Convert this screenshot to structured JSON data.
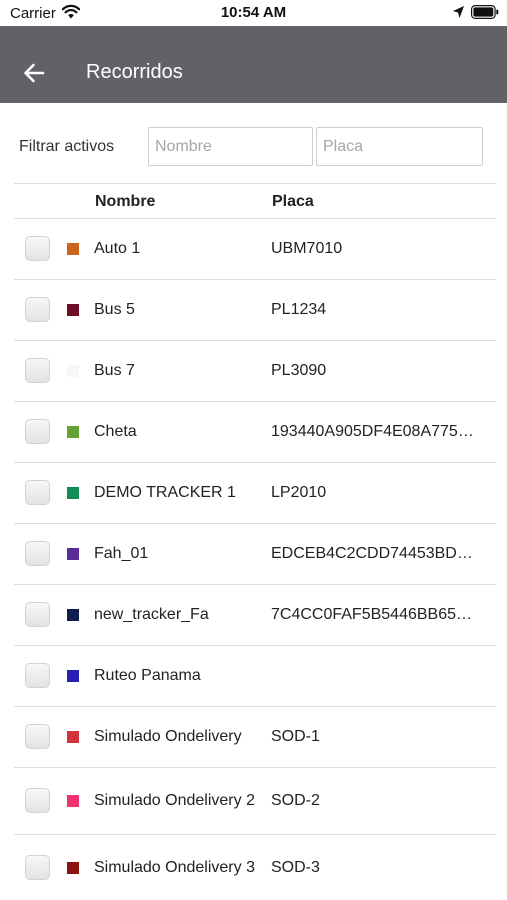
{
  "status_bar": {
    "carrier": "Carrier",
    "time": "10:54 AM",
    "wifi_icon": "wifi-icon",
    "location_icon": "location-arrow-icon",
    "battery_icon": "battery-icon"
  },
  "app_bar": {
    "title": "Recorridos",
    "background": "#616266",
    "back_icon": "arrow-left-icon"
  },
  "filter": {
    "label": "Filtrar activos",
    "name_placeholder": "Nombre",
    "name_value": "",
    "plate_placeholder": "Placa",
    "plate_value": ""
  },
  "table": {
    "headers": {
      "name": "Nombre",
      "plate": "Placa"
    },
    "rows": [
      {
        "name": "Auto 1",
        "plate": "UBM7010",
        "color": "#c8641e",
        "checked": false
      },
      {
        "name": "Bus 5",
        "plate": "PL1234",
        "color": "#6e0f28",
        "checked": false
      },
      {
        "name": "Bus 7",
        "plate": "PL3090",
        "color": "#f7f7f7",
        "checked": false
      },
      {
        "name": "Cheta",
        "plate": "193440A905DF4E08A775…",
        "color": "#64a032",
        "checked": false
      },
      {
        "name": "DEMO TRACKER 1",
        "plate": "LP2010",
        "color": "#148c5a",
        "checked": false
      },
      {
        "name": "Fah_01",
        "plate": "EDCEB4C2CDD74453BD…",
        "color": "#5a2d96",
        "checked": false
      },
      {
        "name": "new_tracker_Fa",
        "plate": "7C4CC0FAF5B5446BB65…",
        "color": "#0f1e50",
        "checked": false
      },
      {
        "name": "Ruteo Panama",
        "plate": "",
        "color": "#281eb4",
        "checked": false
      },
      {
        "name": "Simulado Ondelivery",
        "plate": "SOD-1",
        "color": "#d2323c",
        "checked": false
      },
      {
        "name": "Simulado Ondelivery 2",
        "plate": "SOD-2",
        "color": "#f0326e",
        "checked": false
      },
      {
        "name": "Simulado Ondelivery 3",
        "plate": "SOD-3",
        "color": "#8c140f",
        "checked": false
      }
    ]
  }
}
